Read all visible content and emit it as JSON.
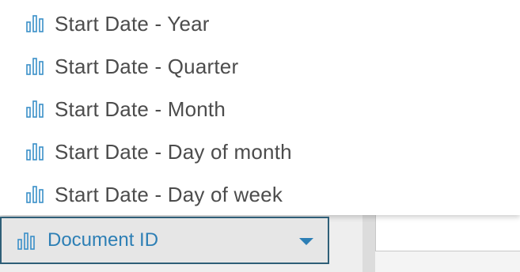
{
  "menu": {
    "items": [
      {
        "label": "Start Date - Year",
        "icon": "bar-chart-icon"
      },
      {
        "label": "Start Date - Quarter",
        "icon": "bar-chart-icon"
      },
      {
        "label": "Start Date - Month",
        "icon": "bar-chart-icon"
      },
      {
        "label": "Start Date - Day of month",
        "icon": "bar-chart-icon"
      },
      {
        "label": "Start Date - Day of week",
        "icon": "bar-chart-icon"
      }
    ]
  },
  "field_select": {
    "selected_value": "Document ID",
    "icon": "bar-chart-icon",
    "expand_icon": "caret-down-icon"
  },
  "colors": {
    "accent": "#2d7fb5",
    "icon": "#3a8fc8",
    "border": "#2f5f78",
    "text": "#4c4c4c"
  }
}
